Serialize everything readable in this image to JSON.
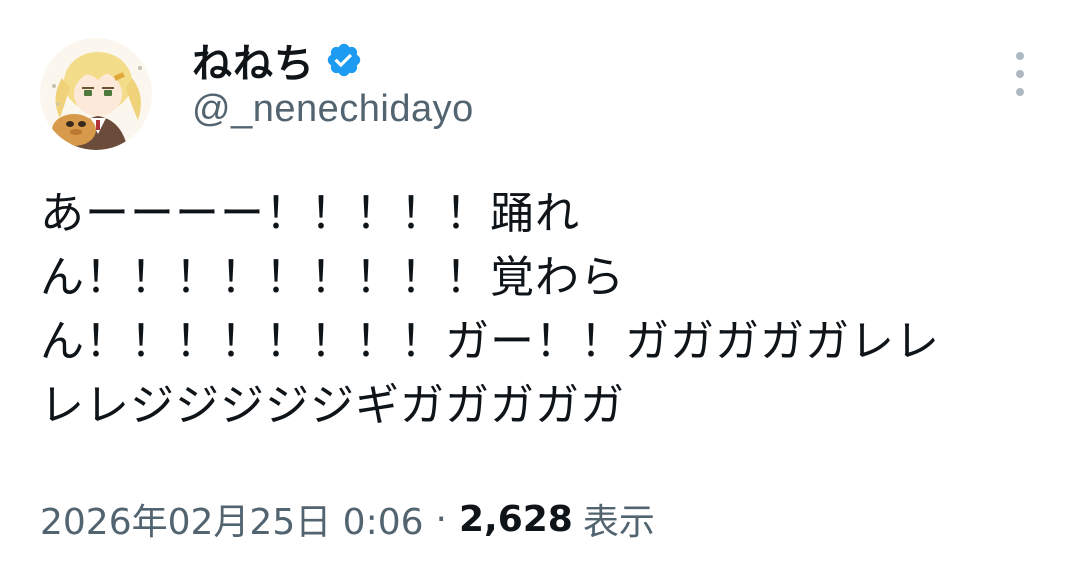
{
  "user": {
    "display_name": "ねねち",
    "handle": "@_nenechidayo",
    "verified_icon": "verified-badge-icon",
    "verified_color": "#1d9bf0"
  },
  "tweet": {
    "lines": [
      "あーーーー！！！！！踊れ",
      "ん！！！！！！！！！覚わら",
      "ん！！！！！！！！ガー！！ガガガガガレレ",
      "レレジジジジジギガガガガガ"
    ]
  },
  "meta": {
    "timestamp": "2026年02月25日 0:06",
    "separator": "·",
    "views_count": "2,628",
    "views_label": "表示"
  },
  "icons": {
    "more": "more-vertical-icon",
    "avatar": "avatar-image"
  }
}
